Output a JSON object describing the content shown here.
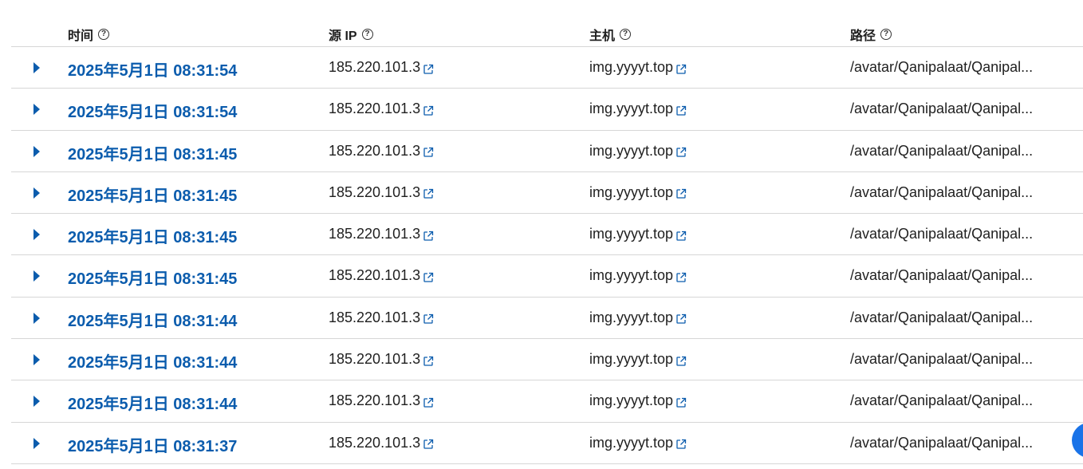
{
  "table": {
    "headers": {
      "time": "时间",
      "source_ip": "源 IP",
      "host": "主机",
      "path": "路径"
    },
    "help_glyph": "?",
    "rows": [
      {
        "time": "2025年5月1日 08:31:54",
        "ip": "185.220.101.3",
        "host": "img.yyyyt.top",
        "path": "/avatar/Qanipalaat/Qanipal..."
      },
      {
        "time": "2025年5月1日 08:31:54",
        "ip": "185.220.101.3",
        "host": "img.yyyyt.top",
        "path": "/avatar/Qanipalaat/Qanipal..."
      },
      {
        "time": "2025年5月1日 08:31:45",
        "ip": "185.220.101.3",
        "host": "img.yyyyt.top",
        "path": "/avatar/Qanipalaat/Qanipal..."
      },
      {
        "time": "2025年5月1日 08:31:45",
        "ip": "185.220.101.3",
        "host": "img.yyyyt.top",
        "path": "/avatar/Qanipalaat/Qanipal..."
      },
      {
        "time": "2025年5月1日 08:31:45",
        "ip": "185.220.101.3",
        "host": "img.yyyyt.top",
        "path": "/avatar/Qanipalaat/Qanipal..."
      },
      {
        "time": "2025年5月1日 08:31:45",
        "ip": "185.220.101.3",
        "host": "img.yyyyt.top",
        "path": "/avatar/Qanipalaat/Qanipal..."
      },
      {
        "time": "2025年5月1日 08:31:44",
        "ip": "185.220.101.3",
        "host": "img.yyyyt.top",
        "path": "/avatar/Qanipalaat/Qanipal..."
      },
      {
        "time": "2025年5月1日 08:31:44",
        "ip": "185.220.101.3",
        "host": "img.yyyyt.top",
        "path": "/avatar/Qanipalaat/Qanipal..."
      },
      {
        "time": "2025年5月1日 08:31:44",
        "ip": "185.220.101.3",
        "host": "img.yyyyt.top",
        "path": "/avatar/Qanipalaat/Qanipal..."
      },
      {
        "time": "2025年5月1日 08:31:37",
        "ip": "185.220.101.3",
        "host": "img.yyyyt.top",
        "path": "/avatar/Qanipalaat/Qanipal..."
      }
    ]
  },
  "icons": {
    "expand": "caret-right-icon",
    "external_link": "external-link-icon",
    "help": "help-circle-icon"
  },
  "colors": {
    "link": "#0b5cad",
    "divider": "#d6d6d6",
    "fab": "#1a73e8"
  }
}
